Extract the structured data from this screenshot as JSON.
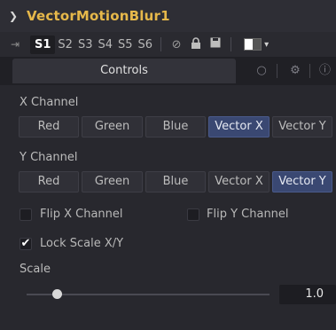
{
  "tool": {
    "name": "VectorMotionBlur1"
  },
  "versions": {
    "items": [
      "S1",
      "S2",
      "S3",
      "S4",
      "S5",
      "S6"
    ],
    "active": "S1"
  },
  "tabs": {
    "controls_label": "Controls"
  },
  "x_channel": {
    "label": "X Channel",
    "options": [
      "Red",
      "Green",
      "Blue",
      "Vector X",
      "Vector Y"
    ],
    "selected": "Vector X"
  },
  "y_channel": {
    "label": "Y Channel",
    "options": [
      "Red",
      "Green",
      "Blue",
      "Vector X",
      "Vector Y"
    ],
    "selected": "Vector Y"
  },
  "checkboxes": {
    "flip_x": {
      "label": "Flip X Channel",
      "checked": false
    },
    "flip_y": {
      "label": "Flip Y Channel",
      "checked": false
    },
    "lock_scale": {
      "label": "Lock Scale X/Y",
      "checked": true
    }
  },
  "scale": {
    "label": "Scale",
    "value": "1.0"
  },
  "colors": {
    "title": "#e6b84a",
    "selected": "#3a4872",
    "background": "#28282e"
  },
  "icons": [
    "chevron-down-icon",
    "pin-icon",
    "disable-icon",
    "lock-icon",
    "save-icon",
    "color-swatch-icon",
    "tab-link-icon",
    "gear-icon",
    "info-icon",
    "checkmark-icon"
  ]
}
